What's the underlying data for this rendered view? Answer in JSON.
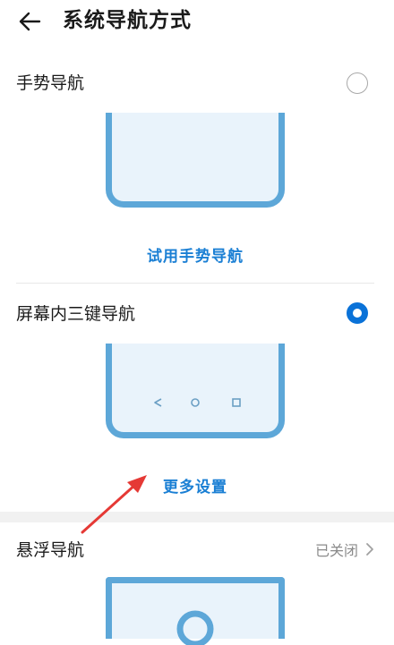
{
  "header": {
    "title": "系统导航方式",
    "back_icon": "arrow-left-icon"
  },
  "options": {
    "gesture": {
      "label": "手势导航",
      "selected": false,
      "link": "试用手势导航"
    },
    "three_key": {
      "label": "屏幕内三键导航",
      "selected": true,
      "link": "更多设置",
      "nav_icons": [
        "triangle-back-icon",
        "circle-home-icon",
        "square-recent-icon"
      ]
    },
    "floating": {
      "label": "悬浮导航",
      "status": "已关闭",
      "chevron": "chevron-right-icon"
    }
  },
  "colors": {
    "accent": "#0a72d8",
    "link": "#1a7fd4",
    "phone_frame": "#5da7d8",
    "phone_screen": "#e9f3fb",
    "annotation_arrow": "#e53935"
  }
}
